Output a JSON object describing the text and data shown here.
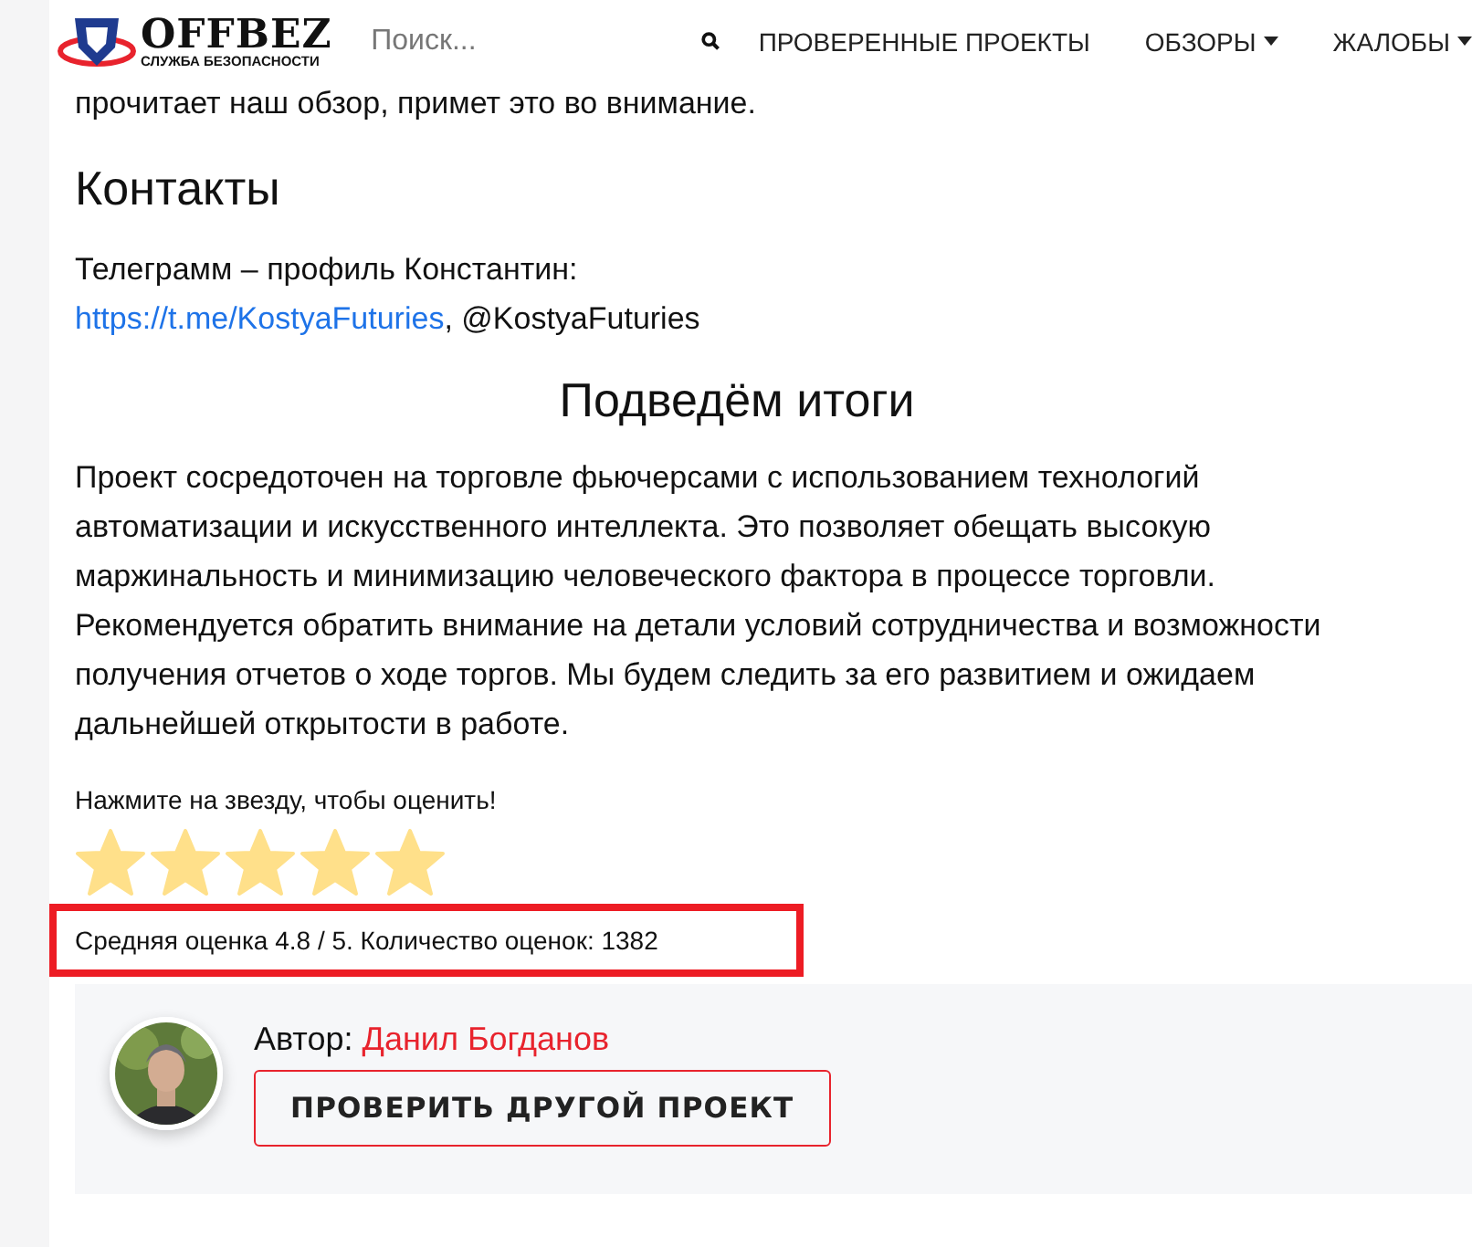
{
  "header": {
    "logo_title": "OFFBEZ",
    "logo_subtitle": "СЛУЖБА БЕЗОПАСНОСТИ",
    "search": {
      "placeholder": "Поиск..."
    },
    "nav": [
      {
        "label": "ПРОВЕРЕННЫЕ ПРОЕКТЫ",
        "dropdown": false
      },
      {
        "label": "ОБЗОРЫ",
        "dropdown": true
      },
      {
        "label": "ЖАЛОБЫ",
        "dropdown": true
      }
    ]
  },
  "article": {
    "intro_tail": "прочитает наш обзор, примет это во внимание.",
    "contacts_heading": "Контакты",
    "contacts_text": "Телеграмм – профиль Константин:",
    "contacts_link": "https://t.me/KostyaFuturies",
    "contacts_handle": ", @KostyaFuturies",
    "summary_heading": "Подведём итоги",
    "summary_text": "Проект сосредоточен на торговле фьючерсами с использованием технологий автоматизации и искусственного интеллекта. Это позволяет обещать высокую маржинальность и минимизацию человеческого фактора в процессе торговли. Рекомендуется обратить внимание на детали условий сотрудничества и возможности получения отчетов о ходе торгов. Мы будем следить за его развитием и ожидаем дальнейшей открытости в работе."
  },
  "rating": {
    "prompt": "Нажмите на звезду, чтобы оценить!",
    "stars": 5,
    "summary": "Средняя оценка 4.8 / 5. Количество оценок: 1382"
  },
  "author": {
    "label": "Автор:",
    "name": "Данил Богданов",
    "button": "ПРОВЕРИТЬ ДРУГОЙ ПРОЕКТ"
  }
}
